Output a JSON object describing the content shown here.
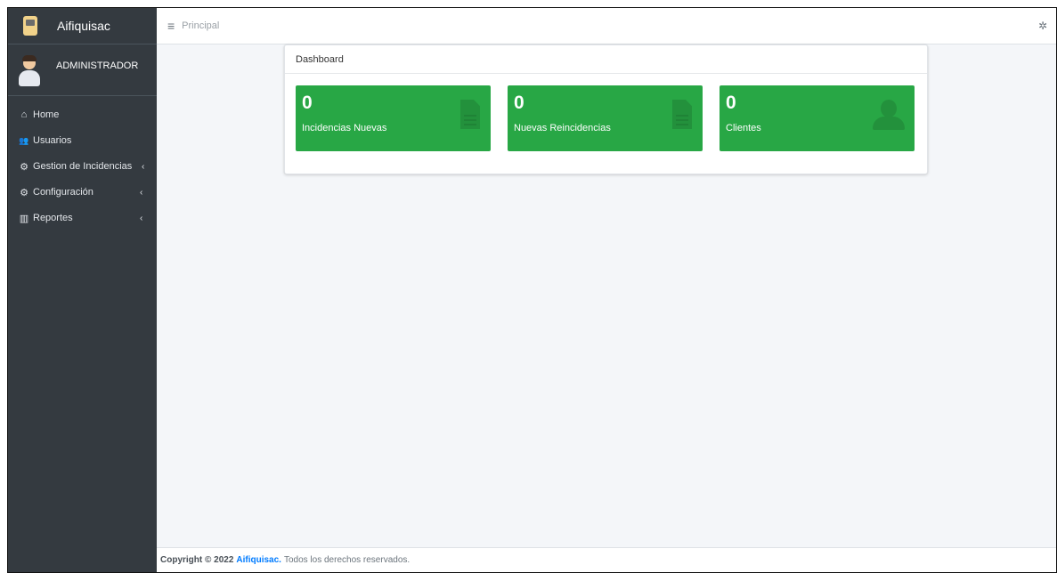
{
  "sidebar": {
    "brand": "Aifiquisac",
    "user": "ADMINISTRADOR",
    "items": [
      {
        "label": "Home",
        "icon": "home-icon",
        "glyph": "⌂",
        "chevron": ""
      },
      {
        "label": "Usuarios",
        "icon": "users-icon",
        "glyph": "👥",
        "chevron": ""
      },
      {
        "label": "Gestion de Incidencias",
        "icon": "cogs-icon",
        "glyph": "⚙",
        "chevron": "‹"
      },
      {
        "label": "Configuración",
        "icon": "cogs-icon",
        "glyph": "⚙",
        "chevron": "‹"
      },
      {
        "label": "Reportes",
        "icon": "chart-icon",
        "glyph": "▥",
        "chevron": "‹"
      }
    ]
  },
  "topbar": {
    "menu_glyph": "≡",
    "breadcrumb": "Principal",
    "settings_glyph": "✲"
  },
  "dashboard": {
    "title": "Dashboard",
    "boxes": [
      {
        "value": "0",
        "label": "Incidencias Nuevas",
        "icon": "document-icon"
      },
      {
        "value": "0",
        "label": "Nuevas Reincidencias",
        "icon": "document-icon"
      },
      {
        "value": "0",
        "label": "Clientes",
        "icon": "user-icon"
      }
    ],
    "box_color": "#28a745"
  },
  "footer": {
    "copyright": "Copyright © 2022",
    "brand": "Aifiquisac.",
    "rights": "Todos los derechos reservados."
  },
  "colors": {
    "sidebar": "#343a40",
    "accent": "#007bff",
    "success": "#28a745"
  }
}
